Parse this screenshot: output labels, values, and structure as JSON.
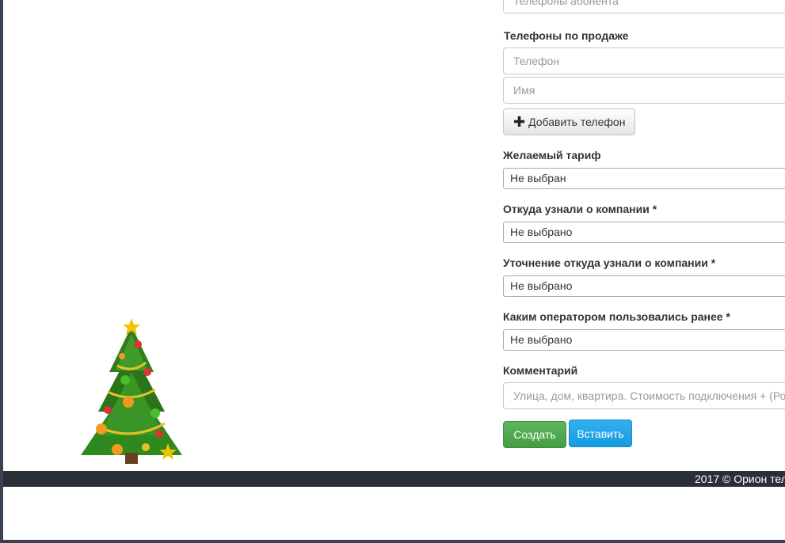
{
  "form": {
    "subscriber_phones_placeholder": "Телефоны абонента",
    "sales_phones_label": "Телефоны по продаже",
    "phone_placeholder": "Телефон",
    "name_placeholder": "Имя",
    "add_phone_label": "Добавить телефон",
    "tariff_label": "Желаемый тариф",
    "tariff_value": "Не выбран",
    "source_label": "Откуда узнали о компании *",
    "source_value": "Не выбрано",
    "source_detail_label": "Уточнение откуда узнали о компании *",
    "source_detail_value": "Не выбрано",
    "prev_operator_label": "Каким оператором пользовались ранее *",
    "prev_operator_value": "Не выбрано",
    "comment_label": "Комментарий",
    "comment_placeholder": "Улица, дом, квартира. Стоимость подключения + (Ро",
    "create_label": "Создать",
    "insert_label": "Вставить"
  },
  "footer": {
    "text": "2017 © Орион тел"
  },
  "decoration": {
    "tree_icon": "christmas-tree-icon"
  },
  "colors": {
    "create_button": "#4cae4c",
    "insert_button": "#1ea4e8",
    "footer_bg": "#2b2f36"
  }
}
